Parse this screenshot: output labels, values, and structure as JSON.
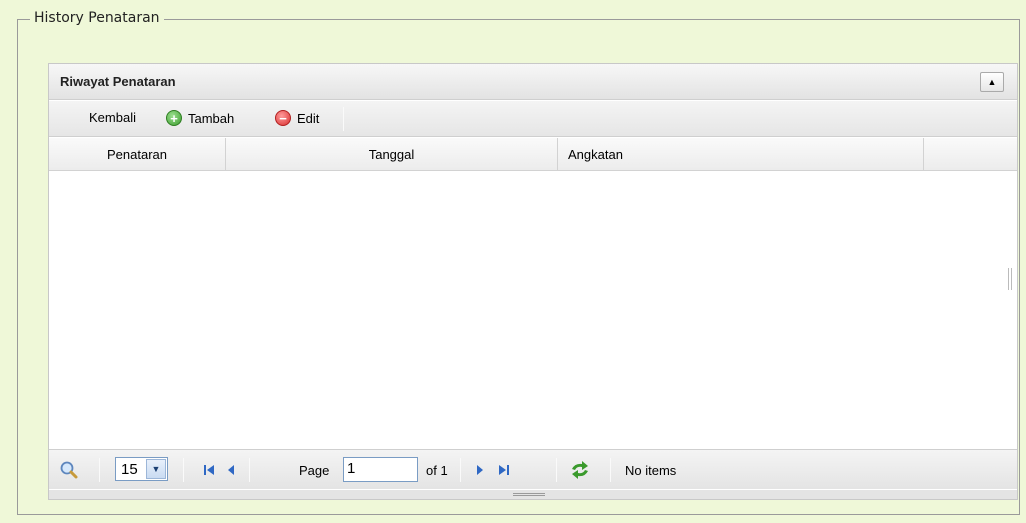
{
  "fieldset": {
    "legend": "History Penataran"
  },
  "grid": {
    "title": "Riwayat Penataran",
    "collapse_icon": "triangle-up-icon",
    "toolbar": {
      "back_label": "Kembali",
      "add_label": "Tambah",
      "edit_label": "Edit"
    },
    "columns": [
      "Penataran",
      "Tanggal",
      "Angkatan",
      ""
    ],
    "rows": []
  },
  "pager": {
    "page_size": "15",
    "page_label": "Page",
    "page_value": "1",
    "of_label": "of 1",
    "status": "No items"
  },
  "colors": {
    "background": "#eff8d8",
    "add_icon": "#3d9c2e",
    "edit_icon": "#d93030",
    "nav_icon": "#2f68c4",
    "refresh_icon": "#3a9a2c"
  }
}
